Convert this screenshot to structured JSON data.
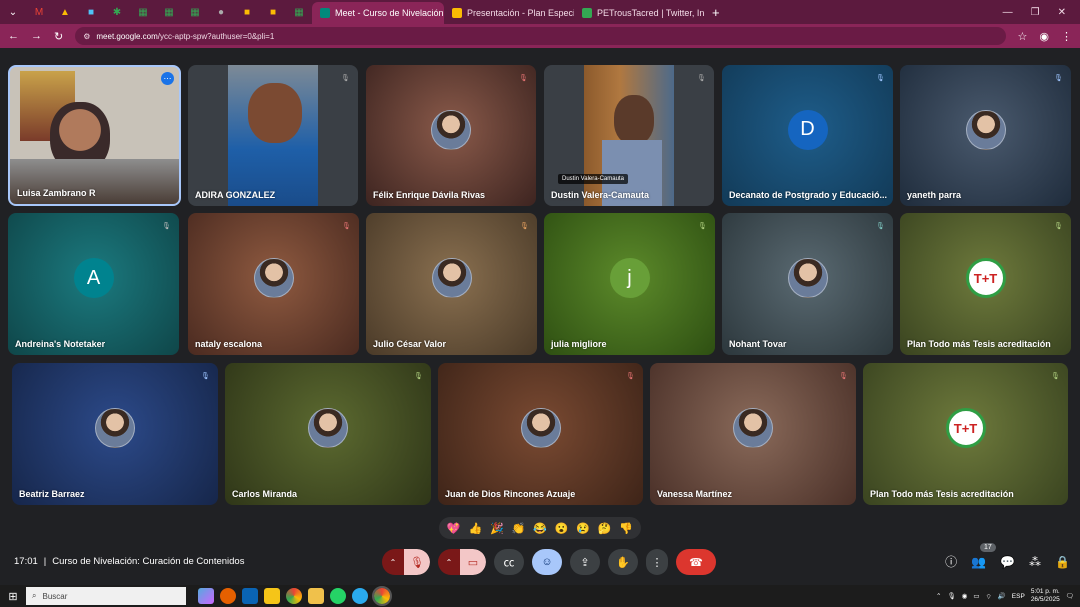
{
  "browser": {
    "tabs": [
      {
        "title": "Meet - Curso de Nivelación",
        "active": true
      },
      {
        "title": "Presentación - Plan Especial Tu",
        "active": false
      },
      {
        "title": "PETrousTacred | Twitter, Instagr",
        "active": false
      }
    ],
    "url_host": "meet.google.com",
    "url_path": "/ycc-aptp-spw?authuser=0&pli=1"
  },
  "participants": [
    {
      "name": "Luisa Zambrano R",
      "kind": "video"
    },
    {
      "name": "ADIRA GONZALEZ",
      "kind": "video"
    },
    {
      "name": "Félix Enrique Dávila Rivas",
      "kind": "photo"
    },
    {
      "name": "Dustin Valera-Camauta",
      "kind": "video",
      "caption": "Dustin Valera-Camauta"
    },
    {
      "name": "Decanato de Postgrado y Educació...",
      "kind": "letter",
      "letter": "D"
    },
    {
      "name": "yaneth parra",
      "kind": "photo"
    },
    {
      "name": "Andreina's Notetaker",
      "kind": "letter",
      "letter": "A"
    },
    {
      "name": "nataly escalona",
      "kind": "photo"
    },
    {
      "name": "Julio César Valor",
      "kind": "photo"
    },
    {
      "name": "julia migliore",
      "kind": "letter",
      "letter": "j"
    },
    {
      "name": "Nohant Tovar",
      "kind": "photo"
    },
    {
      "name": "Plan Todo más Tesis acreditación",
      "kind": "logo"
    },
    {
      "name": "Beatriz Barraez",
      "kind": "photo"
    },
    {
      "name": "Carlos Miranda",
      "kind": "photo"
    },
    {
      "name": "Juan de Dios Rincones Azuaje",
      "kind": "photo"
    },
    {
      "name": "Vanessa Martínez",
      "kind": "photo"
    },
    {
      "name": "Plan Todo más Tesis acreditación",
      "kind": "logo"
    }
  ],
  "reactions": [
    "💖",
    "👍",
    "🎉",
    "👏",
    "😂",
    "😮",
    "😢",
    "🤔",
    "👎"
  ],
  "meeting": {
    "time": "17:01",
    "separator": "|",
    "title": "Curso de Nivelación: Curación de Contenidos",
    "people_count": "17"
  },
  "taskbar": {
    "search_placeholder": "Buscar",
    "lang": "ESP",
    "time": "5:01 p. m.",
    "date": "26/5/2025"
  },
  "colors": {
    "tab_strip": "#5c1a3e",
    "omnibar": "#8a2558",
    "meet_bg": "#202124",
    "leave": "#dc362e"
  }
}
